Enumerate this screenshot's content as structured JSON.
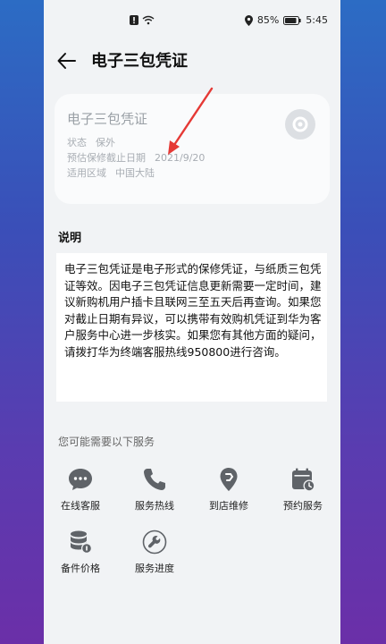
{
  "status_bar": {
    "battery_percent": "85%",
    "time": "5:45"
  },
  "header": {
    "title": "电子三包凭证"
  },
  "card": {
    "title": "电子三包凭证",
    "rows": [
      {
        "label": "状态",
        "value": "保外"
      },
      {
        "label": "预估保修截止日期",
        "value": "2021/9/20"
      },
      {
        "label": "适用区域",
        "value": "中国大陆"
      }
    ]
  },
  "description": {
    "heading": "说明",
    "text": "电子三包凭证是电子形式的保修凭证，与纸质三包凭证等效。因电子三包凭证信息更新需要一定时间，建议新购机用户插卡且联网三至五天后再查询。如果您对截止日期有异议，可以携带有效购机凭证到华为客户服务中心进一步核实。如果您有其他方面的疑问，请拨打华为终端客服热线950800进行咨询。"
  },
  "services": {
    "heading": "您可能需要以下服务",
    "items": [
      {
        "label": "在线客服",
        "icon": "chat-bubble-icon"
      },
      {
        "label": "服务热线",
        "icon": "phone-icon"
      },
      {
        "label": "到店维修",
        "icon": "location-pin-icon"
      },
      {
        "label": "预约服务",
        "icon": "calendar-icon"
      },
      {
        "label": "备件价格",
        "icon": "database-icon"
      },
      {
        "label": "服务进度",
        "icon": "wrench-icon"
      }
    ]
  },
  "colors": {
    "accent_red": "#e53935",
    "icon_gray": "#5f6368"
  }
}
